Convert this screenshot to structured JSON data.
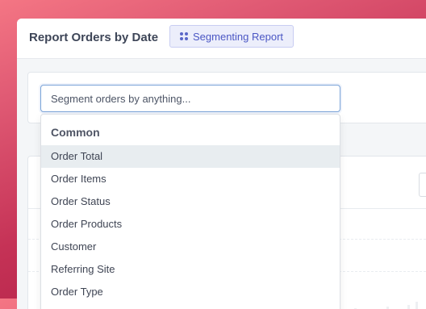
{
  "header": {
    "title": "Report Orders by Date",
    "segment_button": {
      "label": "Segmenting Report",
      "icon": "segment-dots-icon",
      "accent": "#4b57c4"
    }
  },
  "search": {
    "placeholder": "Segment orders by anything..."
  },
  "dropdown": {
    "heading": "Common",
    "highlighted_index": 0,
    "items": [
      {
        "label": "Order Total"
      },
      {
        "label": "Order Items"
      },
      {
        "label": "Order Status"
      },
      {
        "label": "Order Products"
      },
      {
        "label": "Customer"
      },
      {
        "label": "Referring Site"
      },
      {
        "label": "Order Type"
      }
    ]
  },
  "colors": {
    "background_gradient_start": "#f47684",
    "background_gradient_end": "#a8183f",
    "highlight": "#e8edf0"
  }
}
